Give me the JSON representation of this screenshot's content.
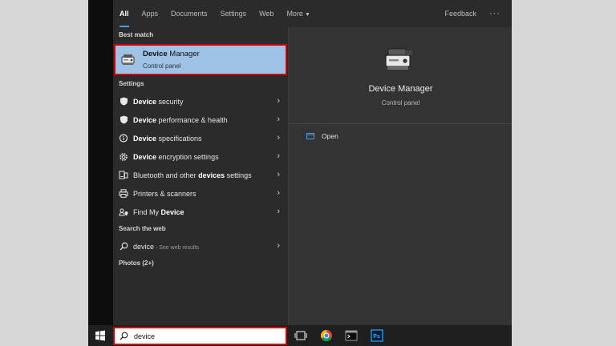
{
  "tabs": {
    "all": "All",
    "apps": "Apps",
    "documents": "Documents",
    "settings": "Settings",
    "web": "Web",
    "more": "More",
    "feedback": "Feedback",
    "overflow": "···"
  },
  "results": {
    "best_match_label": "Best match",
    "best_match": {
      "title_bold": "Device",
      "title_rest": " Manager",
      "subtitle": "Control panel",
      "icon": "device-manager-icon"
    },
    "settings_label": "Settings",
    "settings_items": [
      {
        "bold": "Device",
        "rest": " security",
        "icon": "shield-icon"
      },
      {
        "bold": "Device",
        "rest": " performance & health",
        "icon": "shield-icon"
      },
      {
        "bold": "Device",
        "rest": " specifications",
        "icon": "laptop-icon"
      },
      {
        "bold": "Device",
        "rest": " encryption settings",
        "icon": "gear-icon"
      },
      {
        "pre": "Bluetooth and other ",
        "bold": "devices",
        "rest": " settings",
        "icon": "keyboard-icon"
      },
      {
        "pre": "Printers & scanners",
        "icon": "printer-icon"
      },
      {
        "pre": "Find My ",
        "bold": "Device",
        "icon": "person-location-icon"
      }
    ],
    "web_label": "Search the web",
    "web_item": {
      "query": "device",
      "suffix": " - See web results",
      "icon": "search-icon"
    },
    "photos_label": "Photos (2+)"
  },
  "preview": {
    "title": "Device Manager",
    "subtitle": "Control panel",
    "open_label": "Open",
    "icon": "device-manager-icon"
  },
  "taskbar": {
    "search_value": "device",
    "icons": [
      "windows-start-icon",
      "search-icon",
      "task-view-icon",
      "chrome-icon",
      "terminal-icon",
      "photoshop-icon"
    ]
  },
  "colors": {
    "highlight": "#9fc3e6",
    "callout_border": "#d20000",
    "panel_bg": "#2b2b2b",
    "accent": "#4c9be8"
  }
}
